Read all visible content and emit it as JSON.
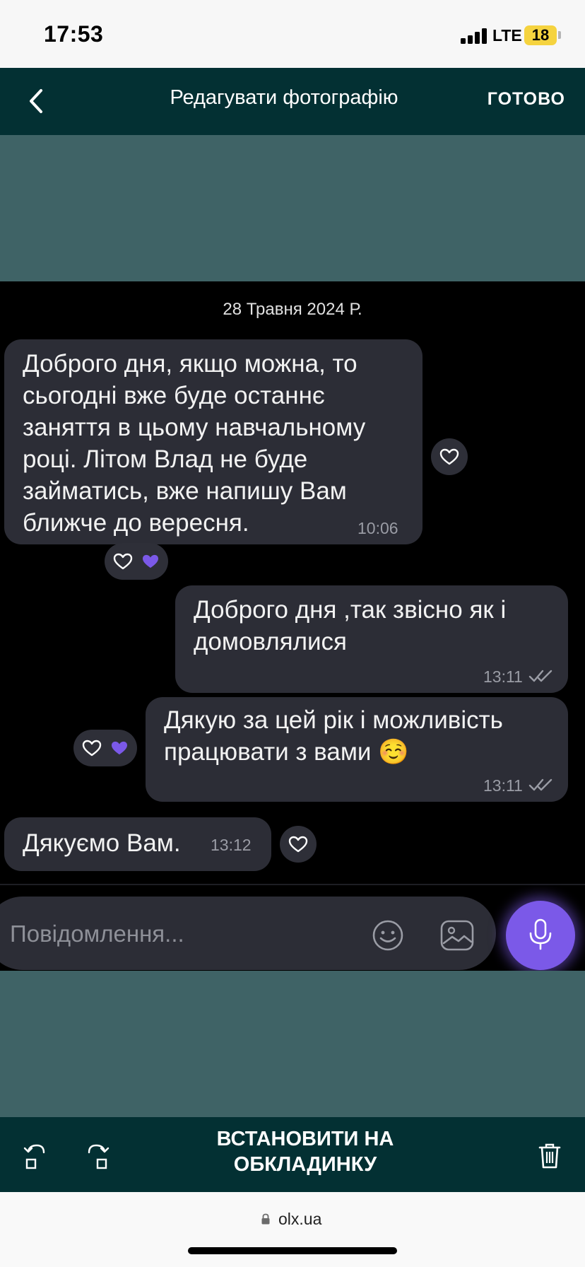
{
  "status_bar": {
    "time": "17:53",
    "network": "LTE",
    "battery": "18"
  },
  "top_bar": {
    "title": "Редагувати фотографію",
    "done_label": "ГОТОВО",
    "back_icon": "chevron-left-icon"
  },
  "chat": {
    "date": "28 Травня 2024 Р.",
    "messages": [
      {
        "direction": "incoming",
        "lines": [
          "Доброго дня, якщо можна, то",
          "сьогодні вже буде останнє",
          "заняття в цьому навчальному",
          "році. Літом Влад не буде",
          "займатись, вже напишу Вам",
          "ближче до вересня."
        ],
        "time": "10:06"
      },
      {
        "direction": "outgoing",
        "lines": [
          "Доброго дня ,так звісно як і",
          "домовлялися"
        ],
        "time": "13:11"
      },
      {
        "direction": "outgoing",
        "lines": [
          "Дякую за цей рік і можливість",
          "працювати з вами ☺️"
        ],
        "time": "13:11"
      },
      {
        "direction": "incoming",
        "lines": [
          "Дякуємо Вам."
        ],
        "time": "13:12"
      }
    ],
    "input_placeholder": "Повідомлення...",
    "colors": {
      "bubble": "#2c2d36",
      "accent": "#7b59e8",
      "background": "#000000"
    }
  },
  "bottom_bar": {
    "set_cover_line1": "ВСТАНОВИТИ НА",
    "set_cover_line2": "ОБКЛАДИНКУ"
  },
  "browser": {
    "url": "olx.ua"
  },
  "colors": {
    "header": "#033033",
    "canvas": "#3f6366"
  }
}
